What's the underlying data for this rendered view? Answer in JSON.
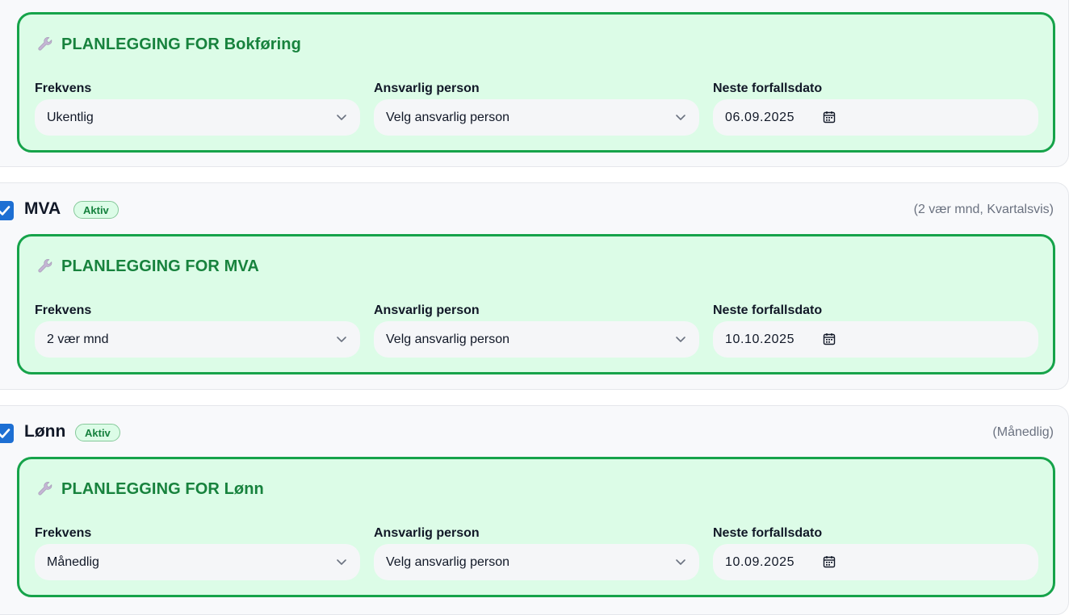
{
  "colors": {
    "accent": "#16a34a",
    "panel_bg": "#dcfce7",
    "checkbox": "#1d6fd3",
    "title": "#17823d"
  },
  "field_labels": {
    "frequency": "Frekvens",
    "responsible": "Ansvarlig person",
    "due_date": "Neste forfallsdato"
  },
  "services": [
    {
      "name": "Bokføring",
      "plan_title": "PLANLEGGING FOR Bokføring",
      "frequency_value": "Ukentlig",
      "responsible_value": "Velg ansvarlig person",
      "due_date_value": "06.09.2025"
    },
    {
      "name": "MVA",
      "checked": true,
      "badge": "Aktiv",
      "summary": "(2 vær mnd, Kvartalsvis)",
      "plan_title": "PLANLEGGING FOR MVA",
      "frequency_value": "2 vær mnd",
      "responsible_value": "Velg ansvarlig person",
      "due_date_value": "10.10.2025"
    },
    {
      "name": "Lønn",
      "checked": true,
      "badge": "Aktiv",
      "summary": "(Månedlig)",
      "plan_title": "PLANLEGGING FOR Lønn",
      "frequency_value": "Månedlig",
      "responsible_value": "Velg ansvarlig person",
      "due_date_value": "10.09.2025"
    }
  ]
}
